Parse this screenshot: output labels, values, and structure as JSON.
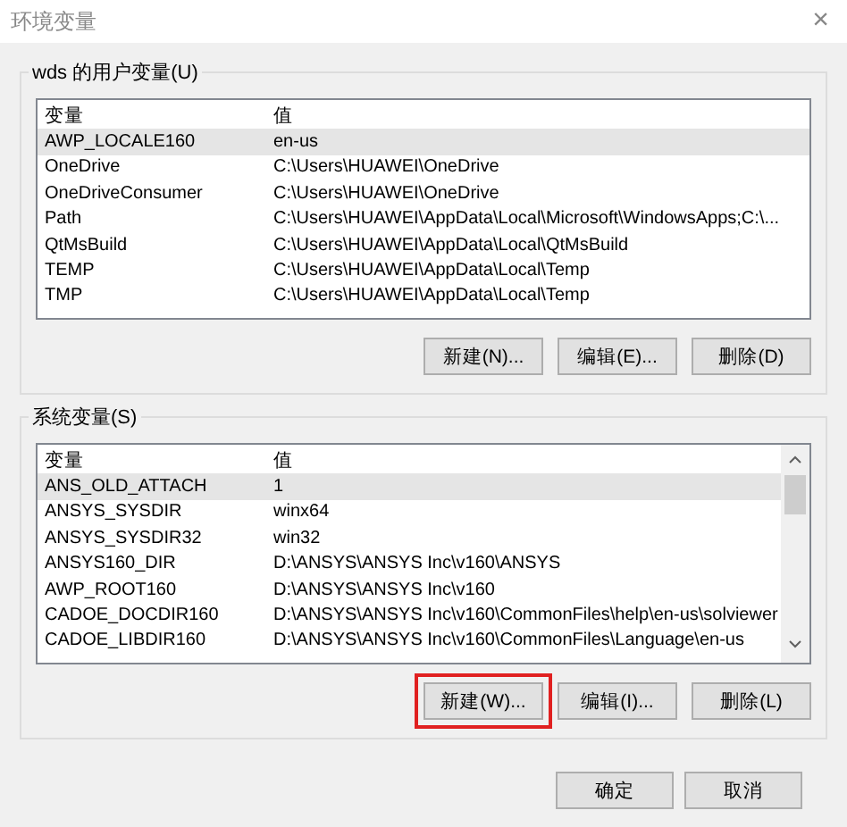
{
  "window": {
    "title": "环境变量",
    "close": "×"
  },
  "user_vars": {
    "label": "wds 的用户变量(U)",
    "columns": [
      "变量",
      "值"
    ],
    "rows": [
      {
        "name": "AWP_LOCALE160",
        "value": "en-us",
        "selected": true
      },
      {
        "name": "OneDrive",
        "value": "C:\\Users\\HUAWEI\\OneDrive",
        "selected": false
      },
      {
        "name": "OneDriveConsumer",
        "value": "C:\\Users\\HUAWEI\\OneDrive",
        "selected": false
      },
      {
        "name": "Path",
        "value": "C:\\Users\\HUAWEI\\AppData\\Local\\Microsoft\\WindowsApps;C:\\...",
        "selected": false
      },
      {
        "name": "QtMsBuild",
        "value": "C:\\Users\\HUAWEI\\AppData\\Local\\QtMsBuild",
        "selected": false
      },
      {
        "name": "TEMP",
        "value": "C:\\Users\\HUAWEI\\AppData\\Local\\Temp",
        "selected": false
      },
      {
        "name": "TMP",
        "value": "C:\\Users\\HUAWEI\\AppData\\Local\\Temp",
        "selected": false
      }
    ],
    "buttons": [
      {
        "label": "新建(N)...",
        "highlighted": false
      },
      {
        "label": "编辑(E)...",
        "highlighted": false
      },
      {
        "label": "删除(D)",
        "highlighted": false
      }
    ]
  },
  "system_vars": {
    "label": "系统变量(S)",
    "columns": [
      "变量",
      "值"
    ],
    "rows": [
      {
        "name": "ANS_OLD_ATTACH",
        "value": "1",
        "selected": true
      },
      {
        "name": "ANSYS_SYSDIR",
        "value": "winx64",
        "selected": false
      },
      {
        "name": "ANSYS_SYSDIR32",
        "value": "win32",
        "selected": false
      },
      {
        "name": "ANSYS160_DIR",
        "value": "D:\\ANSYS\\ANSYS Inc\\v160\\ANSYS",
        "selected": false
      },
      {
        "name": "AWP_ROOT160",
        "value": "D:\\ANSYS\\ANSYS Inc\\v160",
        "selected": false
      },
      {
        "name": "CADOE_DOCDIR160",
        "value": "D:\\ANSYS\\ANSYS Inc\\v160\\CommonFiles\\help\\en-us\\solviewer",
        "selected": false
      },
      {
        "name": "CADOE_LIBDIR160",
        "value": "D:\\ANSYS\\ANSYS Inc\\v160\\CommonFiles\\Language\\en-us",
        "selected": false
      }
    ],
    "buttons": [
      {
        "label": "新建(W)...",
        "highlighted": true
      },
      {
        "label": "编辑(I)...",
        "highlighted": false
      },
      {
        "label": "删除(L)",
        "highlighted": false
      }
    ]
  },
  "footer_buttons": [
    "确定",
    "取消"
  ]
}
